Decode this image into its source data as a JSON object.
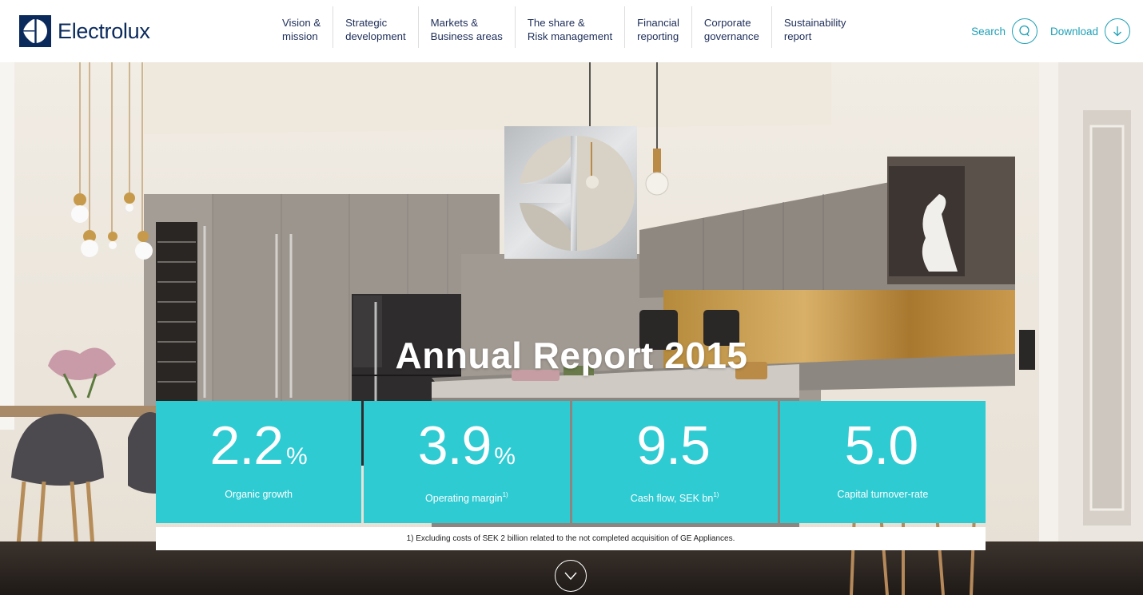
{
  "brand": {
    "name": "Electrolux",
    "logo_icon": "electrolux-logo-icon",
    "color": "#0b2a5c"
  },
  "nav": {
    "items": [
      {
        "line1": "Vision &",
        "line2": "mission"
      },
      {
        "line1": "Strategic",
        "line2": "development"
      },
      {
        "line1": "Markets &",
        "line2": "Business areas"
      },
      {
        "line1": "The share &",
        "line2": "Risk management"
      },
      {
        "line1": "Financial",
        "line2": "reporting"
      },
      {
        "line1": "Corporate",
        "line2": "governance"
      },
      {
        "line1": "Sustainability",
        "line2": "report"
      }
    ]
  },
  "utility": {
    "search_label": "Search",
    "search_icon": "search-icon",
    "download_label": "Download",
    "download_icon": "arrow-down-icon",
    "accent": "#1ea0b6"
  },
  "hero": {
    "title": "Annual Report 2015",
    "kpis": [
      {
        "value": "2.2",
        "unit": "%",
        "label": "Organic growth",
        "footnote_ref": ""
      },
      {
        "value": "3.9",
        "unit": "%",
        "label": "Operating margin",
        "footnote_ref": "1)"
      },
      {
        "value": "9.5",
        "unit": "",
        "label": "Cash flow, SEK bn",
        "footnote_ref": "1)"
      },
      {
        "value": "5.0",
        "unit": "",
        "label": "Capital turnover-rate",
        "footnote_ref": ""
      }
    ],
    "kpi_color": "#2ecbd3",
    "footnote": "1) Excluding costs of SEK 2 billion related to the not completed acquisition of GE Appliances.",
    "scroll_icon": "chevron-down-icon"
  }
}
